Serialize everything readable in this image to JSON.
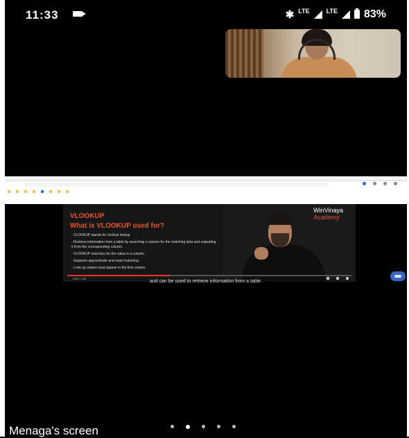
{
  "status_bar": {
    "time": "11:33",
    "battery": "83%",
    "icons": [
      "video-recording-icon",
      "bluetooth-icon",
      "volte-icon",
      "lte-signal-icon",
      "battery-icon"
    ]
  },
  "shared_screen": {
    "browser_bookmarks": [
      "",
      "",
      "",
      "",
      "",
      "",
      "",
      ""
    ],
    "slide": {
      "title": "VLOOKUP",
      "subtitle": "What is VLOOKUP used for?",
      "bullets": [
        "- VLOOKUP stands for Vertical lookup",
        "- Retrieve information from a table by searching a column for the matching data and outputting it from the corresponding column.",
        "- VLOOKUP searches for the value in a column.",
        "- Supports approximate and exact matching.",
        "- Look up values must appear in the first column."
      ],
      "brand_line1": "WinVinaya",
      "brand_line2": "Academy"
    },
    "video_time": "0:32 / 1:30",
    "video_progress": 0.36,
    "caption": "and can be used to retrieve information from a table."
  },
  "footer": {
    "screen_owner_label": "Menaga's screen",
    "page_indicator": {
      "count": 5,
      "active_index": 1
    }
  }
}
